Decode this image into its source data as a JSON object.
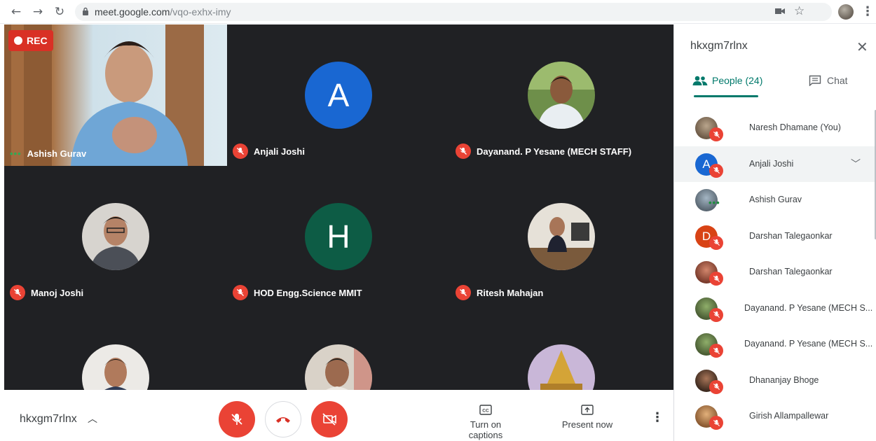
{
  "browser": {
    "url_host": "meet.google.com",
    "url_path": "/vqo-exhx-imy"
  },
  "meeting": {
    "rec_label": "REC",
    "tiles": [
      {
        "name": "Ashish Gurav",
        "kind": "video",
        "speaking": true
      },
      {
        "name": "Anjali Joshi",
        "kind": "letter",
        "letter": "A",
        "color": "#1967d2"
      },
      {
        "name": "Dayanand. P Yesane (MECH STAFF)",
        "kind": "photo"
      },
      {
        "name": "Manoj Joshi",
        "kind": "photo"
      },
      {
        "name": "HOD Engg.Science MMIT",
        "kind": "letter",
        "letter": "H",
        "color": "#0d5c45"
      },
      {
        "name": "Ritesh Mahajan",
        "kind": "photo"
      },
      {
        "name": "",
        "kind": "photo"
      },
      {
        "name": "",
        "kind": "photo"
      },
      {
        "name": "",
        "kind": "photo"
      }
    ]
  },
  "bottombar": {
    "meeting_code": "hkxgm7rlnx",
    "captions_label": "Turn on captions",
    "present_label": "Present now"
  },
  "panel": {
    "title": "hkxgm7rlnx",
    "people_tab": "People (24)",
    "chat_tab": "Chat",
    "people": [
      {
        "name": "Naresh Dhamane (You)",
        "avatar": "photo",
        "muted": true
      },
      {
        "name": "Anjali Joshi",
        "avatar": "letter",
        "letter": "A",
        "color": "#1967d2",
        "muted": true,
        "highlighted": true
      },
      {
        "name": "Ashish Gurav",
        "avatar": "photo",
        "muted": false,
        "speaking": true
      },
      {
        "name": "Darshan Talegaonkar",
        "avatar": "letter",
        "letter": "D",
        "color": "#d84315",
        "muted": true
      },
      {
        "name": "Darshan Talegaonkar",
        "avatar": "photo",
        "muted": true
      },
      {
        "name": "Dayanand. P Yesane (MECH S...",
        "avatar": "photo",
        "muted": true
      },
      {
        "name": "Dayanand. P Yesane (MECH S...",
        "avatar": "photo",
        "muted": true
      },
      {
        "name": "Dhananjay Bhoge",
        "avatar": "photo",
        "muted": true
      },
      {
        "name": "Girish Allampallewar",
        "avatar": "photo",
        "muted": true
      }
    ]
  },
  "colors": {
    "accent": "#00796b",
    "danger": "#ea4335",
    "stage": "#202124"
  }
}
